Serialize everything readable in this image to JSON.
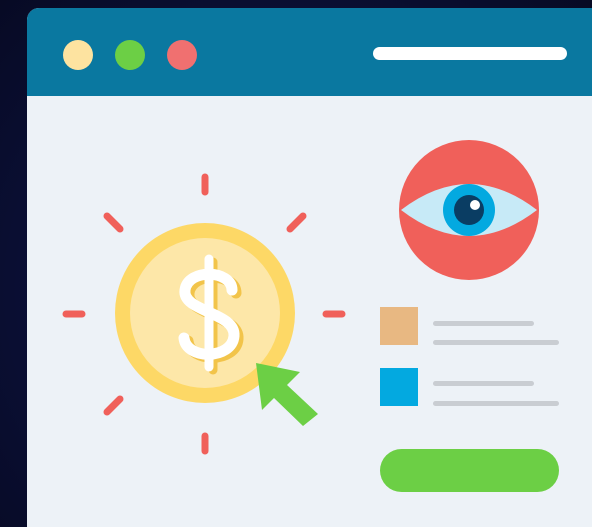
{
  "window": {
    "title_dots": [
      {
        "name": "minimize-dot",
        "color": "#fde3a0"
      },
      {
        "name": "maximize-dot",
        "color": "#6ccf45"
      },
      {
        "name": "close-dot",
        "color": "#f07070"
      }
    ],
    "titlebar_color": "#0a78a0",
    "content_background": "#edf2f7"
  },
  "illustration": {
    "coin_icon": "dollar-coin-icon",
    "coin_symbol": "$",
    "coin_color": "#fdd866",
    "ray_color": "#f0605a",
    "cursor_icon": "pointer-arrow-icon",
    "cursor_color": "#6ccf45",
    "eye_icon": "eye-icon",
    "eye_badge_color": "#f0605a"
  },
  "legend": {
    "items": [
      {
        "name": "legend-item-orange",
        "swatch_color": "#e8b882"
      },
      {
        "name": "legend-item-blue",
        "swatch_color": "#03a9e0"
      }
    ]
  },
  "action_button": {
    "color": "#6ccf45"
  }
}
